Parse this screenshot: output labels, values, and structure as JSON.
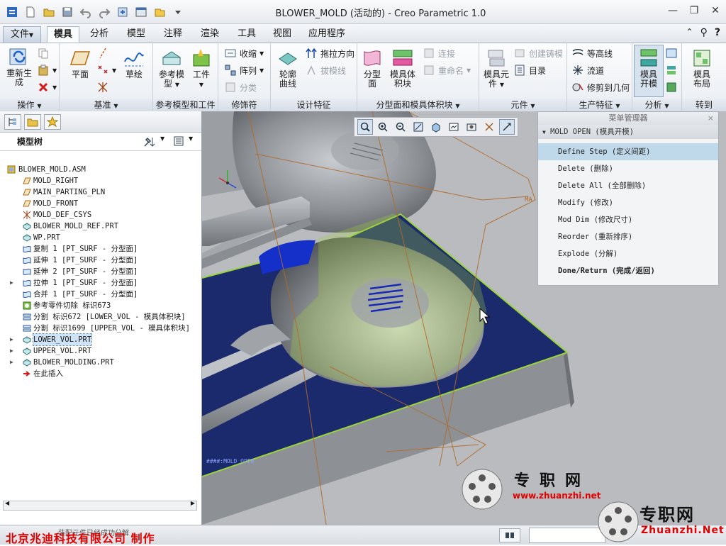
{
  "window": {
    "title": "BLOWER_MOLD (活动的) - Creo Parametric 1.0"
  },
  "menubar": {
    "tabs": [
      "文件",
      "模具",
      "分析",
      "模型",
      "注释",
      "渲染",
      "工具",
      "视图",
      "应用程序"
    ],
    "file_arrow": "▼"
  },
  "ribbon": {
    "groups": {
      "operation": "操作",
      "datum": "基准",
      "ref_model": "参考模型和工件",
      "decor": "修饰符",
      "design": "设计特征",
      "parting": "分型面和模具体积块",
      "component": "元件",
      "production": "生产特征",
      "analysis": "分析",
      "goto": "转到"
    },
    "buttons": {
      "regen": "重新生",
      "regen2": "成",
      "plane": "平面",
      "sketch": "草绘",
      "refmodel": "参考模",
      "refmodel2": "型",
      "workpiece": "工件",
      "shrink": "收缩",
      "pattern": "阵列",
      "classify": "分类",
      "silhouette": "轮廓",
      "silhouette2": "曲线",
      "draw_dir": "拖拉方向",
      "draft_check": "拔模线",
      "parting_surf": "分型",
      "parting_surf2": "面",
      "mold_volume": "模具体",
      "mold_volume2": "积块",
      "connect": "连接",
      "rename": "重命名",
      "mold_comp": "模具元",
      "mold_comp2": "件",
      "create_casting": "创建铸模",
      "catalog": "目录",
      "contour": "等高线",
      "runner": "流道",
      "trim_geom": "修剪到几何",
      "mold_open": "模具",
      "mold_open2": "开模",
      "mold_layout": "模具",
      "mold_layout2": "布局"
    }
  },
  "model_tree": {
    "header": "模型树",
    "items": [
      {
        "label": "BLOWER_MOLD.ASM",
        "icon": "assembly-icon",
        "root": true
      },
      {
        "label": "MOLD_RIGHT",
        "icon": "datum-plane-icon"
      },
      {
        "label": "MAIN_PARTING_PLN",
        "icon": "datum-plane-icon"
      },
      {
        "label": "MOLD_FRONT",
        "icon": "datum-plane-icon"
      },
      {
        "label": "MOLD_DEF_CSYS",
        "icon": "csys-icon"
      },
      {
        "label": "BLOWER_MOLD_REF.PRT",
        "icon": "part-icon"
      },
      {
        "label": "WP.PRT",
        "icon": "part-icon"
      },
      {
        "label": "复制 1 [PT_SURF - 分型面]",
        "icon": "surface-icon"
      },
      {
        "label": "延伸 1 [PT_SURF - 分型面]",
        "icon": "surface-icon"
      },
      {
        "label": "延伸 2 [PT_SURF - 分型面]",
        "icon": "surface-icon"
      },
      {
        "label": "拉伸 1 [PT_SURF - 分型面]",
        "icon": "surface-icon",
        "expand": true
      },
      {
        "label": "合并 1 [PT_SURF - 分型面]",
        "icon": "surface-icon"
      },
      {
        "label": "参考零件切除 标识673",
        "icon": "cut-icon"
      },
      {
        "label": "分割 标识672 [LOWER_VOL - 模具体积块]",
        "icon": "split-icon"
      },
      {
        "label": "分割 标识1699 [UPPER_VOL - 模具体积块]",
        "icon": "split-icon"
      },
      {
        "label": "LOWER_VOL.PRT",
        "icon": "part-icon",
        "expand": true,
        "selected": true
      },
      {
        "label": "UPPER_VOL.PRT",
        "icon": "part-icon",
        "expand": true
      },
      {
        "label": "BLOWER_MOLDING.PRT",
        "icon": "part-icon",
        "expand": true
      },
      {
        "label": "在此插入",
        "icon": "insert-here-icon"
      }
    ]
  },
  "viewport": {
    "datum_label": "MA",
    "model_label": "####:MOLD_OPEN"
  },
  "menu_manager": {
    "title": "菜单管理器",
    "close": "×",
    "submenu": "MOLD OPEN (模具开模)",
    "items": [
      {
        "label": "Define Step (定义间距)",
        "highlight": true
      },
      {
        "label": "Delete (删除)"
      },
      {
        "label": "Delete All (全部删除)"
      },
      {
        "label": "Modify (修改)"
      },
      {
        "label": "Mod Dim (修改尺寸)"
      },
      {
        "label": "Reorder (重新排序)"
      },
      {
        "label": "Explode (分解)"
      },
      {
        "label": "Done/Return (完成/返回)",
        "bold": true
      }
    ]
  },
  "status": {
    "company": "北京兆迪科技有限公司    制作",
    "message": "装配元件已经成功分解"
  },
  "watermark": {
    "cn": "专职网",
    "url": "www.zhuanzhi.net",
    "cn2": "专职网",
    "url2": "Zhuanzhi.Net"
  },
  "colors": {
    "accent": "#cfe3f7",
    "company_red": "#e00000",
    "mold_blue": "#1a2a6c",
    "mold_gray": "#8d9196",
    "parting_green": "#9ad33a"
  }
}
